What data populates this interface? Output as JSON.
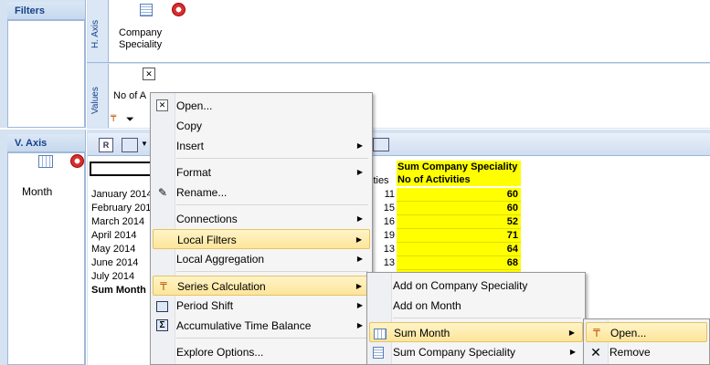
{
  "filters": {
    "title": "Filters"
  },
  "haxis": {
    "label": "H. Axis",
    "field": "Company Speciality"
  },
  "values": {
    "label": "Values",
    "field": "No of A"
  },
  "vaxis": {
    "title": "V. Axis",
    "field": "Month"
  },
  "grid": {
    "rows": [
      "January 2014",
      "February 2014",
      "March 2014",
      "April 2014",
      "May 2014",
      "June 2014",
      "July 2014",
      "Sum Month"
    ],
    "partial_header": "ities",
    "col_header_1": "Sum Company Speciality",
    "col_header_2": "No of Activities",
    "counts": [
      "11",
      "15",
      "16",
      "19",
      "13",
      "13"
    ],
    "sums": [
      "60",
      "60",
      "52",
      "71",
      "64",
      "68"
    ]
  },
  "context_menu": {
    "items": [
      {
        "label": "Open...",
        "icon": "open-icon"
      },
      {
        "label": "Copy"
      },
      {
        "label": "Insert",
        "submenu": true
      },
      {
        "label": "Format",
        "submenu": true
      },
      {
        "label": "Rename...",
        "icon": "pencil-icon"
      },
      {
        "label": "Connections",
        "submenu": true
      },
      {
        "label": "Local Filters",
        "submenu": true
      },
      {
        "label": "Local Aggregation",
        "submenu": true
      },
      {
        "label": "Series Calculation",
        "submenu": true,
        "icon": "series-calc-icon"
      },
      {
        "label": "Period Shift",
        "submenu": true,
        "icon": "period-shift-icon"
      },
      {
        "label": "Accumulative Time Balance",
        "submenu": true,
        "icon": "sigma-icon"
      },
      {
        "label": "Explore Options..."
      }
    ]
  },
  "submenu1": {
    "items": [
      {
        "label": "Add on Company Speciality"
      },
      {
        "label": "Add on Month"
      },
      {
        "label": "Sum Month",
        "submenu": true
      },
      {
        "label": "Sum Company Speciality",
        "submenu": true
      }
    ]
  },
  "submenu2": {
    "items": [
      {
        "label": "Open..."
      },
      {
        "label": "Remove"
      }
    ]
  },
  "colors": {
    "highlight": "#fde59a",
    "panel_header": "#c6d8ee",
    "data_yellow": "#ffff00",
    "header_text": "#15428b"
  }
}
